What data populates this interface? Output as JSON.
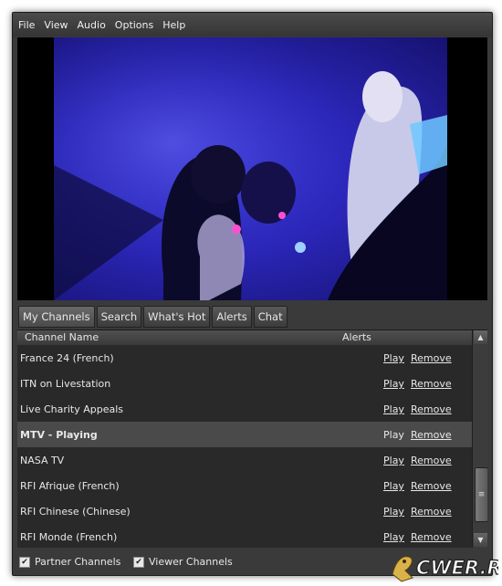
{
  "menubar": {
    "items": [
      "File",
      "View",
      "Audio",
      "Options",
      "Help"
    ]
  },
  "tabs": [
    {
      "label": "My Channels",
      "active": true
    },
    {
      "label": "Search",
      "active": false
    },
    {
      "label": "What's Hot",
      "active": false
    },
    {
      "label": "Alerts",
      "active": false
    },
    {
      "label": "Chat",
      "active": false
    }
  ],
  "list": {
    "columns": [
      "Channel Name",
      "Alerts"
    ],
    "rows": [
      {
        "name": "France 24 (French)",
        "play": "Play",
        "remove": "Remove",
        "playing": false
      },
      {
        "name": "ITN on Livestation",
        "play": "Play",
        "remove": "Remove",
        "playing": false
      },
      {
        "name": "Live Charity Appeals",
        "play": "Play",
        "remove": "Remove",
        "playing": false
      },
      {
        "name": "MTV  -  Playing",
        "play": "Play",
        "remove": "Remove",
        "playing": true
      },
      {
        "name": "NASA TV",
        "play": "Play",
        "remove": "Remove",
        "playing": false
      },
      {
        "name": "RFI Afrique (French)",
        "play": "Play",
        "remove": "Remove",
        "playing": false
      },
      {
        "name": "RFI Chinese (Chinese)",
        "play": "Play",
        "remove": "Remove",
        "playing": false
      },
      {
        "name": "RFI Monde (French)",
        "play": "Play",
        "remove": "Remove",
        "playing": false
      }
    ]
  },
  "footer": {
    "partner_label": "Partner Channels",
    "partner_checked": true,
    "viewer_label": "Viewer Channels",
    "viewer_checked": true
  },
  "watermark": "CWER.RU",
  "colors": {
    "window_bg": "#3a3a3a",
    "list_bg": "#2a2a2a",
    "playing_row_bg": "#4a4a4a",
    "video_tint": "#2b26b8"
  }
}
